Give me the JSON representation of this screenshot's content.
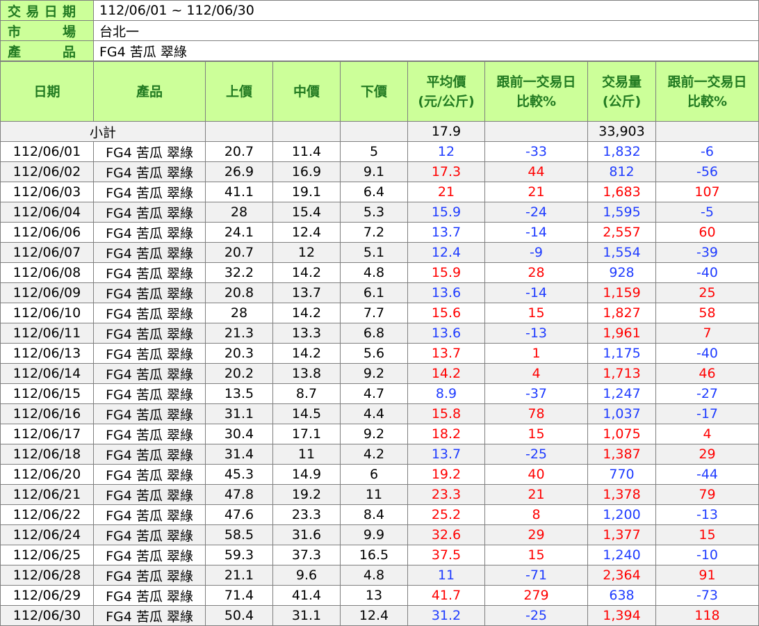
{
  "info": {
    "date_label": [
      "交",
      "易",
      "日",
      "期"
    ],
    "date_value": "112/06/01 ~ 112/06/30",
    "market_label": [
      "市",
      "場"
    ],
    "market_value": "台北一",
    "product_label": [
      "產",
      "品"
    ],
    "product_value": "FG4 苦瓜 翠綠"
  },
  "headers": [
    [
      "日期"
    ],
    [
      "產品"
    ],
    [
      "上價"
    ],
    [
      "中價"
    ],
    [
      "下價"
    ],
    [
      "平均價",
      "(元/公斤)"
    ],
    [
      "跟前一交易日",
      "比較%"
    ],
    [
      "交易量",
      "(公斤)"
    ],
    [
      "跟前一交易日",
      "比較%"
    ]
  ],
  "subtotal": {
    "label": "小計",
    "avg_price": "17.9",
    "volume": "33,903"
  },
  "colors": {
    "header_bg": "#ccff99",
    "header_text": "#217a21",
    "up": "#ff0000",
    "down": "#1f3cff",
    "stripe": "#f1f1f1"
  },
  "rows": [
    {
      "date": "112/06/01",
      "product": "FG4 苦瓜 翠綠",
      "high": "20.7",
      "mid": "11.4",
      "low": "5",
      "avg": "12",
      "avg_pct": "-33",
      "vol": "1,832",
      "vol_pct": "-6"
    },
    {
      "date": "112/06/02",
      "product": "FG4 苦瓜 翠綠",
      "high": "26.9",
      "mid": "16.9",
      "low": "9.1",
      "avg": "17.3",
      "avg_pct": "44",
      "vol": "812",
      "vol_pct": "-56"
    },
    {
      "date": "112/06/03",
      "product": "FG4 苦瓜 翠綠",
      "high": "41.1",
      "mid": "19.1",
      "low": "6.4",
      "avg": "21",
      "avg_pct": "21",
      "vol": "1,683",
      "vol_pct": "107"
    },
    {
      "date": "112/06/04",
      "product": "FG4 苦瓜 翠綠",
      "high": "28",
      "mid": "15.4",
      "low": "5.3",
      "avg": "15.9",
      "avg_pct": "-24",
      "vol": "1,595",
      "vol_pct": "-5"
    },
    {
      "date": "112/06/06",
      "product": "FG4 苦瓜 翠綠",
      "high": "24.1",
      "mid": "12.4",
      "low": "7.2",
      "avg": "13.7",
      "avg_pct": "-14",
      "vol": "2,557",
      "vol_pct": "60"
    },
    {
      "date": "112/06/07",
      "product": "FG4 苦瓜 翠綠",
      "high": "20.7",
      "mid": "12",
      "low": "5.1",
      "avg": "12.4",
      "avg_pct": "-9",
      "vol": "1,554",
      "vol_pct": "-39"
    },
    {
      "date": "112/06/08",
      "product": "FG4 苦瓜 翠綠",
      "high": "32.2",
      "mid": "14.2",
      "low": "4.8",
      "avg": "15.9",
      "avg_pct": "28",
      "vol": "928",
      "vol_pct": "-40"
    },
    {
      "date": "112/06/09",
      "product": "FG4 苦瓜 翠綠",
      "high": "20.8",
      "mid": "13.7",
      "low": "6.1",
      "avg": "13.6",
      "avg_pct": "-14",
      "vol": "1,159",
      "vol_pct": "25"
    },
    {
      "date": "112/06/10",
      "product": "FG4 苦瓜 翠綠",
      "high": "28",
      "mid": "14.2",
      "low": "7.7",
      "avg": "15.6",
      "avg_pct": "15",
      "vol": "1,827",
      "vol_pct": "58"
    },
    {
      "date": "112/06/11",
      "product": "FG4 苦瓜 翠綠",
      "high": "21.3",
      "mid": "13.3",
      "low": "6.8",
      "avg": "13.6",
      "avg_pct": "-13",
      "vol": "1,961",
      "vol_pct": "7"
    },
    {
      "date": "112/06/13",
      "product": "FG4 苦瓜 翠綠",
      "high": "20.3",
      "mid": "14.2",
      "low": "5.6",
      "avg": "13.7",
      "avg_pct": "1",
      "vol": "1,175",
      "vol_pct": "-40"
    },
    {
      "date": "112/06/14",
      "product": "FG4 苦瓜 翠綠",
      "high": "20.2",
      "mid": "13.8",
      "low": "9.2",
      "avg": "14.2",
      "avg_pct": "4",
      "vol": "1,713",
      "vol_pct": "46"
    },
    {
      "date": "112/06/15",
      "product": "FG4 苦瓜 翠綠",
      "high": "13.5",
      "mid": "8.7",
      "low": "4.7",
      "avg": "8.9",
      "avg_pct": "-37",
      "vol": "1,247",
      "vol_pct": "-27"
    },
    {
      "date": "112/06/16",
      "product": "FG4 苦瓜 翠綠",
      "high": "31.1",
      "mid": "14.5",
      "low": "4.4",
      "avg": "15.8",
      "avg_pct": "78",
      "vol": "1,037",
      "vol_pct": "-17"
    },
    {
      "date": "112/06/17",
      "product": "FG4 苦瓜 翠綠",
      "high": "30.4",
      "mid": "17.1",
      "low": "9.2",
      "avg": "18.2",
      "avg_pct": "15",
      "vol": "1,075",
      "vol_pct": "4"
    },
    {
      "date": "112/06/18",
      "product": "FG4 苦瓜 翠綠",
      "high": "31.4",
      "mid": "11",
      "low": "4.2",
      "avg": "13.7",
      "avg_pct": "-25",
      "vol": "1,387",
      "vol_pct": "29"
    },
    {
      "date": "112/06/20",
      "product": "FG4 苦瓜 翠綠",
      "high": "45.3",
      "mid": "14.9",
      "low": "6",
      "avg": "19.2",
      "avg_pct": "40",
      "vol": "770",
      "vol_pct": "-44"
    },
    {
      "date": "112/06/21",
      "product": "FG4 苦瓜 翠綠",
      "high": "47.8",
      "mid": "19.2",
      "low": "11",
      "avg": "23.3",
      "avg_pct": "21",
      "vol": "1,378",
      "vol_pct": "79"
    },
    {
      "date": "112/06/22",
      "product": "FG4 苦瓜 翠綠",
      "high": "47.6",
      "mid": "23.3",
      "low": "8.4",
      "avg": "25.2",
      "avg_pct": "8",
      "vol": "1,200",
      "vol_pct": "-13"
    },
    {
      "date": "112/06/24",
      "product": "FG4 苦瓜 翠綠",
      "high": "58.5",
      "mid": "31.6",
      "low": "9.9",
      "avg": "32.6",
      "avg_pct": "29",
      "vol": "1,377",
      "vol_pct": "15"
    },
    {
      "date": "112/06/25",
      "product": "FG4 苦瓜 翠綠",
      "high": "59.3",
      "mid": "37.3",
      "low": "16.5",
      "avg": "37.5",
      "avg_pct": "15",
      "vol": "1,240",
      "vol_pct": "-10"
    },
    {
      "date": "112/06/28",
      "product": "FG4 苦瓜 翠綠",
      "high": "21.1",
      "mid": "9.6",
      "low": "4.8",
      "avg": "11",
      "avg_pct": "-71",
      "vol": "2,364",
      "vol_pct": "91"
    },
    {
      "date": "112/06/29",
      "product": "FG4 苦瓜 翠綠",
      "high": "71.4",
      "mid": "41.4",
      "low": "13",
      "avg": "41.7",
      "avg_pct": "279",
      "vol": "638",
      "vol_pct": "-73"
    },
    {
      "date": "112/06/30",
      "product": "FG4 苦瓜 翠綠",
      "high": "50.4",
      "mid": "31.1",
      "low": "12.4",
      "avg": "31.2",
      "avg_pct": "-25",
      "vol": "1,394",
      "vol_pct": "118"
    }
  ]
}
